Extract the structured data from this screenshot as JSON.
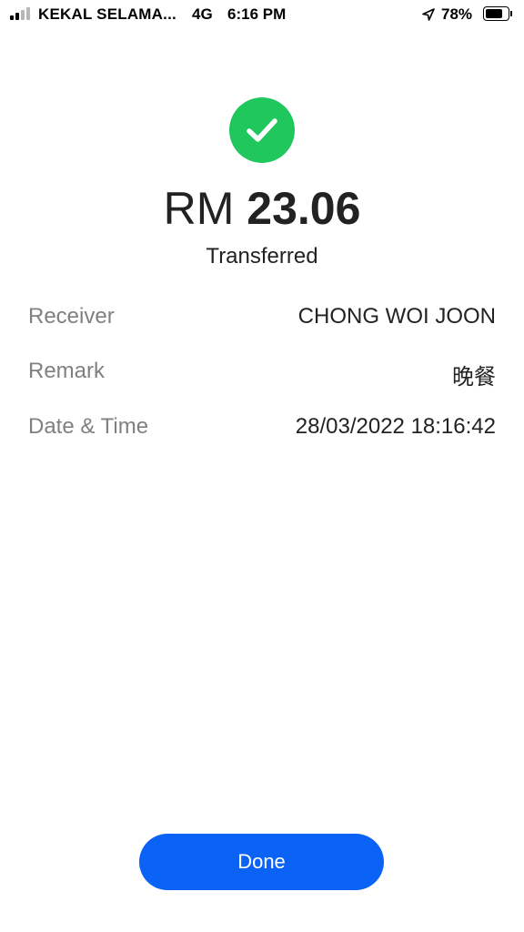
{
  "status_bar": {
    "carrier": "KEKAL SELAMA...",
    "network": "4G",
    "time": "6:16 PM",
    "battery_percent": "78%",
    "signal_icon": "signal-bars-icon",
    "location_icon": "location-arrow-icon",
    "battery_icon": "battery-icon",
    "battery_level": 0.78
  },
  "receipt": {
    "success_icon": "check-circle-icon",
    "success_color": "#1fc75c",
    "currency": "RM",
    "amount": "23.06",
    "status": "Transferred",
    "details": {
      "receiver_label": "Receiver",
      "receiver_value": "CHONG WOI JOON",
      "remark_label": "Remark",
      "remark_value": "晚餐",
      "datetime_label": "Date & Time",
      "datetime_value": "28/03/2022 18:16:42"
    }
  },
  "actions": {
    "done_label": "Done",
    "done_color": "#0b63f6"
  }
}
